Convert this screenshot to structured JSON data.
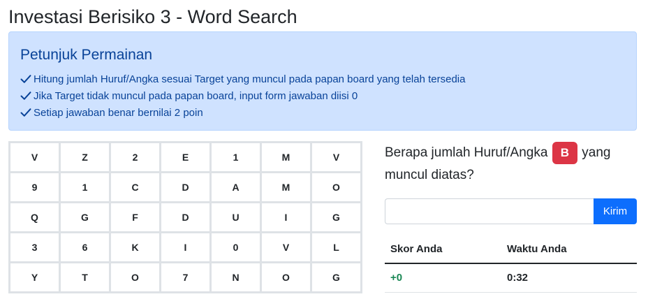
{
  "page": {
    "title": "Investasi Berisiko 3 - Word Search"
  },
  "instructions": {
    "title": "Petunjuk Permainan",
    "items": [
      "Hitung jumlah Huruf/Angka sesuai Target yang muncul pada papan board yang telah tersedia",
      "Jika Target tidak muncul pada papan board, input form jawaban diisi 0",
      "Setiap jawaban benar bernilai 2 poin"
    ],
    "icon": "check-icon"
  },
  "board": [
    [
      "V",
      "Z",
      "2",
      "E",
      "1",
      "M",
      "V"
    ],
    [
      "9",
      "1",
      "C",
      "D",
      "A",
      "M",
      "O"
    ],
    [
      "Q",
      "G",
      "F",
      "D",
      "U",
      "I",
      "G"
    ],
    [
      "3",
      "6",
      "K",
      "I",
      "0",
      "V",
      "L"
    ],
    [
      "Y",
      "T",
      "O",
      "7",
      "N",
      "O",
      "G"
    ]
  ],
  "question": {
    "prefix": "Berapa jumlah Huruf/Angka",
    "target": "B",
    "suffix": "yang muncul diatas?"
  },
  "answer": {
    "value": "",
    "placeholder": "",
    "submit_label": "Kirim"
  },
  "score": {
    "score_header": "Skor Anda",
    "time_header": "Waktu Anda",
    "score_value": "+0",
    "time_value": "0:32"
  },
  "colors": {
    "info_bg": "#cfe2ff",
    "info_text": "#084298",
    "target_badge": "#dc3545",
    "submit_button": "#0d6efd",
    "score_positive": "#198754"
  }
}
